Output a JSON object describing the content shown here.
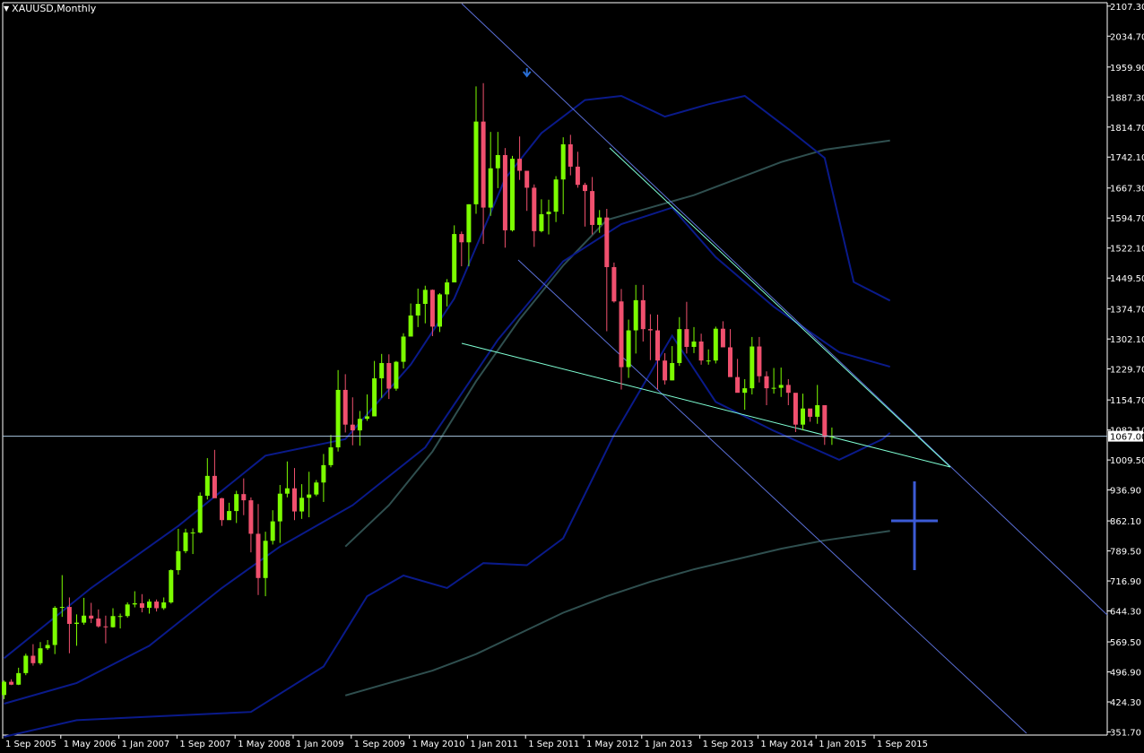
{
  "window": {
    "title": "XAUUSD,Monthly",
    "menu_icon": "triangle-down-icon"
  },
  "colors": {
    "background": "#000000",
    "axis": "#ffffff",
    "bull_candle": "#7CFC00",
    "bear_candle": "#F0506E",
    "bollinger": "#0A1A8A",
    "moving_average": "#2F4F4F",
    "channel_line": "#5A6FD6",
    "support_line": "#7FFFD4",
    "current_price_line": "#A9C6E0",
    "arrow_marker": "#2A6FD6",
    "crosshair": "#3C5BD6"
  },
  "chart_data": {
    "type": "candlestick",
    "symbol": "XAUUSD",
    "timeframe": "Monthly",
    "current_price": "1067.00",
    "ylim": [
      351.7,
      2150
    ],
    "y_ticks": [
      "2107.30",
      "2034.70",
      "1959.90",
      "1887.30",
      "1814.70",
      "1742.10",
      "1667.30",
      "1594.70",
      "1522.10",
      "1449.50",
      "1374.70",
      "1302.10",
      "1229.70",
      "1154.70",
      "1082.10",
      "1009.50",
      "936.90",
      "862.10",
      "789.50",
      "716.90",
      "644.30",
      "569.50",
      "496.90",
      "424.30",
      "351.70"
    ],
    "x_ticks": [
      "1 Sep 2005",
      "1 May 2006",
      "1 Jan 2007",
      "1 Sep 2007",
      "1 May 2008",
      "1 Jan 2009",
      "1 Sep 2009",
      "1 May 2010",
      "1 Jan 2011",
      "1 Sep 2011",
      "1 May 2012",
      "1 Jan 2013",
      "1 Sep 2013",
      "1 May 2014",
      "1 Jan 2015",
      "1 Sep 2015"
    ],
    "start_month": "2005-08",
    "candles": [
      [
        441,
        476,
        431,
        473
      ],
      [
        473,
        479,
        465,
        466
      ],
      [
        466,
        507,
        465,
        494
      ],
      [
        494,
        541,
        489,
        536
      ],
      [
        536,
        564,
        512,
        518
      ],
      [
        518,
        569,
        514,
        554
      ],
      [
        554,
        574,
        550,
        562
      ],
      [
        562,
        656,
        540,
        652
      ],
      [
        652,
        731,
        630,
        654
      ],
      [
        654,
        677,
        542,
        613
      ],
      [
        613,
        636,
        560,
        616
      ],
      [
        616,
        676,
        611,
        633
      ],
      [
        633,
        664,
        615,
        626
      ],
      [
        626,
        648,
        604,
        607
      ],
      [
        607,
        633,
        566,
        605
      ],
      [
        605,
        651,
        604,
        632
      ],
      [
        632,
        638,
        602,
        632
      ],
      [
        632,
        665,
        628,
        660
      ],
      [
        660,
        692,
        653,
        663
      ],
      [
        663,
        685,
        641,
        652
      ],
      [
        652,
        673,
        638,
        667
      ],
      [
        667,
        672,
        643,
        651
      ],
      [
        651,
        677,
        647,
        665
      ],
      [
        665,
        745,
        662,
        743
      ],
      [
        743,
        843,
        732,
        789
      ],
      [
        789,
        843,
        784,
        834
      ],
      [
        834,
        844,
        782,
        834
      ],
      [
        834,
        931,
        832,
        923
      ],
      [
        923,
        1014,
        914,
        971
      ],
      [
        971,
        1034,
        926,
        917
      ],
      [
        917,
        918,
        850,
        864
      ],
      [
        864,
        906,
        865,
        886
      ],
      [
        886,
        935,
        857,
        927
      ],
      [
        927,
        965,
        876,
        912
      ],
      [
        912,
        919,
        786,
        831
      ],
      [
        831,
        903,
        683,
        724
      ],
      [
        724,
        836,
        680,
        814
      ],
      [
        814,
        888,
        805,
        861
      ],
      [
        861,
        949,
        809,
        928
      ],
      [
        928,
        1006,
        919,
        941
      ],
      [
        941,
        990,
        864,
        885
      ],
      [
        885,
        951,
        867,
        918
      ],
      [
        918,
        981,
        871,
        926
      ],
      [
        926,
        961,
        922,
        955
      ],
      [
        955,
        1024,
        908,
        997
      ],
      [
        997,
        1070,
        992,
        1040
      ],
      [
        1040,
        1227,
        1030,
        1179
      ],
      [
        1179,
        1217,
        1076,
        1095
      ],
      [
        1095,
        1161,
        1045,
        1081
      ],
      [
        1081,
        1128,
        1044,
        1109
      ],
      [
        1109,
        1168,
        1104,
        1115
      ],
      [
        1115,
        1249,
        1115,
        1207
      ],
      [
        1207,
        1266,
        1160,
        1244
      ],
      [
        1244,
        1265,
        1157,
        1182
      ],
      [
        1182,
        1249,
        1177,
        1247
      ],
      [
        1247,
        1316,
        1231,
        1308
      ],
      [
        1308,
        1388,
        1309,
        1359
      ],
      [
        1359,
        1424,
        1331,
        1387
      ],
      [
        1387,
        1431,
        1340,
        1421
      ],
      [
        1421,
        1422,
        1309,
        1332
      ],
      [
        1332,
        1413,
        1319,
        1410
      ],
      [
        1410,
        1447,
        1381,
        1439
      ],
      [
        1439,
        1577,
        1461,
        1556
      ],
      [
        1556,
        1562,
        1478,
        1536
      ],
      [
        1536,
        1628,
        1478,
        1628
      ],
      [
        1628,
        1913,
        1605,
        1828
      ],
      [
        1828,
        1921,
        1532,
        1620
      ],
      [
        1620,
        1803,
        1600,
        1715
      ],
      [
        1715,
        1803,
        1667,
        1747
      ],
      [
        1747,
        1764,
        1523,
        1565
      ],
      [
        1565,
        1745,
        1562,
        1738
      ],
      [
        1738,
        1792,
        1687,
        1709
      ],
      [
        1709,
        1696,
        1612,
        1668
      ],
      [
        1668,
        1676,
        1525,
        1563
      ],
      [
        1563,
        1640,
        1560,
        1604
      ],
      [
        1604,
        1639,
        1555,
        1610
      ],
      [
        1610,
        1696,
        1585,
        1688
      ],
      [
        1688,
        1790,
        1604,
        1773
      ],
      [
        1773,
        1796,
        1698,
        1719
      ],
      [
        1719,
        1755,
        1668,
        1675
      ],
      [
        1675,
        1680,
        1574,
        1660
      ],
      [
        1660,
        1694,
        1555,
        1578
      ],
      [
        1578,
        1614,
        1559,
        1596
      ],
      [
        1596,
        1617,
        1321,
        1476
      ],
      [
        1476,
        1487,
        1390,
        1393
      ],
      [
        1393,
        1423,
        1180,
        1234
      ],
      [
        1234,
        1349,
        1208,
        1323
      ],
      [
        1323,
        1433,
        1267,
        1396
      ],
      [
        1396,
        1433,
        1296,
        1326
      ],
      [
        1326,
        1362,
        1251,
        1323
      ],
      [
        1323,
        1361,
        1181,
        1250
      ],
      [
        1250,
        1268,
        1192,
        1202
      ],
      [
        1202,
        1285,
        1202,
        1244
      ],
      [
        1244,
        1355,
        1237,
        1326
      ],
      [
        1326,
        1392,
        1267,
        1283
      ],
      [
        1283,
        1331,
        1268,
        1296
      ],
      [
        1296,
        1315,
        1240,
        1250
      ],
      [
        1250,
        1277,
        1240,
        1250
      ],
      [
        1250,
        1332,
        1243,
        1327
      ],
      [
        1327,
        1345,
        1284,
        1282
      ],
      [
        1282,
        1326,
        1211,
        1210
      ],
      [
        1210,
        1254,
        1183,
        1172
      ],
      [
        1172,
        1205,
        1131,
        1183
      ],
      [
        1183,
        1307,
        1168,
        1284
      ],
      [
        1284,
        1307,
        1197,
        1212
      ],
      [
        1212,
        1224,
        1142,
        1183
      ],
      [
        1183,
        1232,
        1170,
        1184
      ],
      [
        1184,
        1233,
        1162,
        1191
      ],
      [
        1191,
        1205,
        1142,
        1172
      ],
      [
        1172,
        1121,
        1077,
        1095
      ],
      [
        1095,
        1170,
        1081,
        1134
      ],
      [
        1134,
        1128,
        1102,
        1114
      ],
      [
        1114,
        1191,
        1097,
        1142
      ],
      [
        1142,
        1120,
        1046,
        1065
      ],
      [
        1065,
        1088,
        1046,
        1067
      ]
    ],
    "indicators": {
      "ma_short_points": [
        [
          "2009-07",
          800
        ],
        [
          "2010-01",
          900
        ],
        [
          "2010-07",
          1030
        ],
        [
          "2011-01",
          1200
        ],
        [
          "2011-07",
          1350
        ],
        [
          "2012-01",
          1480
        ],
        [
          "2012-07",
          1590
        ],
        [
          "2013-01",
          1620
        ],
        [
          "2013-07",
          1650
        ],
        [
          "2014-01",
          1690
        ],
        [
          "2014-07",
          1730
        ],
        [
          "2015-01",
          1760
        ],
        [
          "2015-10",
          1782
        ]
      ],
      "ma_long_points": [
        [
          "2009-07",
          440
        ],
        [
          "2010-01",
          470
        ],
        [
          "2010-07",
          500
        ],
        [
          "2011-01",
          540
        ],
        [
          "2011-07",
          590
        ],
        [
          "2012-01",
          640
        ],
        [
          "2012-07",
          680
        ],
        [
          "2013-01",
          715
        ],
        [
          "2013-07",
          745
        ],
        [
          "2014-01",
          770
        ],
        [
          "2014-07",
          795
        ],
        [
          "2015-01",
          815
        ],
        [
          "2015-10",
          838
        ]
      ],
      "bb_upper_points": [
        [
          "2005-08",
          530
        ],
        [
          "2006-08",
          700
        ],
        [
          "2007-08",
          850
        ],
        [
          "2008-08",
          1020
        ],
        [
          "2009-07",
          1060
        ],
        [
          "2010-04",
          1240
        ],
        [
          "2010-10",
          1400
        ],
        [
          "2011-05",
          1690
        ],
        [
          "2011-10",
          1800
        ],
        [
          "2012-04",
          1880
        ],
        [
          "2012-09",
          1890
        ],
        [
          "2013-03",
          1840
        ],
        [
          "2013-09",
          1870
        ],
        [
          "2014-02",
          1890
        ],
        [
          "2014-08",
          1810
        ],
        [
          "2015-01",
          1740
        ],
        [
          "2015-05",
          1440
        ],
        [
          "2015-10",
          1395
        ]
      ],
      "bb_middle_points": [
        [
          "2005-08",
          420
        ],
        [
          "2006-06",
          470
        ],
        [
          "2007-04",
          560
        ],
        [
          "2008-02",
          700
        ],
        [
          "2008-10",
          800
        ],
        [
          "2009-08",
          900
        ],
        [
          "2010-06",
          1040
        ],
        [
          "2011-04",
          1300
        ],
        [
          "2012-01",
          1490
        ],
        [
          "2012-09",
          1580
        ],
        [
          "2013-04",
          1620
        ],
        [
          "2013-10",
          1500
        ],
        [
          "2014-06",
          1380
        ],
        [
          "2015-03",
          1270
        ],
        [
          "2015-10",
          1235
        ]
      ],
      "bb_lower_points": [
        [
          "2005-08",
          340
        ],
        [
          "2006-06",
          380
        ],
        [
          "2007-06",
          390
        ],
        [
          "2008-06",
          400
        ],
        [
          "2009-04",
          510
        ],
        [
          "2009-10",
          680
        ],
        [
          "2010-03",
          730
        ],
        [
          "2010-09",
          700
        ],
        [
          "2011-02",
          760
        ],
        [
          "2011-08",
          755
        ],
        [
          "2012-01",
          820
        ],
        [
          "2012-08",
          1070
        ],
        [
          "2013-04",
          1310
        ],
        [
          "2013-10",
          1150
        ],
        [
          "2014-06",
          1080
        ],
        [
          "2015-03",
          1010
        ],
        [
          "2015-09",
          1060
        ],
        [
          "2015-10",
          1075
        ]
      ]
    },
    "annotations": {
      "down_arrow_at": [
        "2011-08",
        1912
      ]
    }
  }
}
